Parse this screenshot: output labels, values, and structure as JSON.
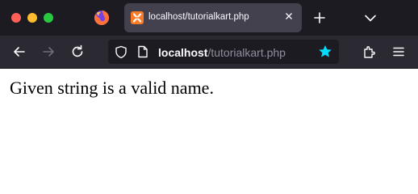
{
  "window": {
    "controls": [
      "close",
      "minimize",
      "maximize"
    ],
    "colors": {
      "close": "#ff5f57",
      "minimize": "#febc2e",
      "maximize": "#28c840"
    }
  },
  "tabs": [
    {
      "title": "localhost/tutorialkart.php",
      "favicon": "xampp-icon",
      "active": true
    }
  ],
  "toolbar": {
    "url_host": "localhost",
    "url_path": "/tutorialkart.php",
    "bookmarked": true,
    "accent_color": "#00ddff"
  },
  "page": {
    "text": "Given string is a valid name."
  }
}
